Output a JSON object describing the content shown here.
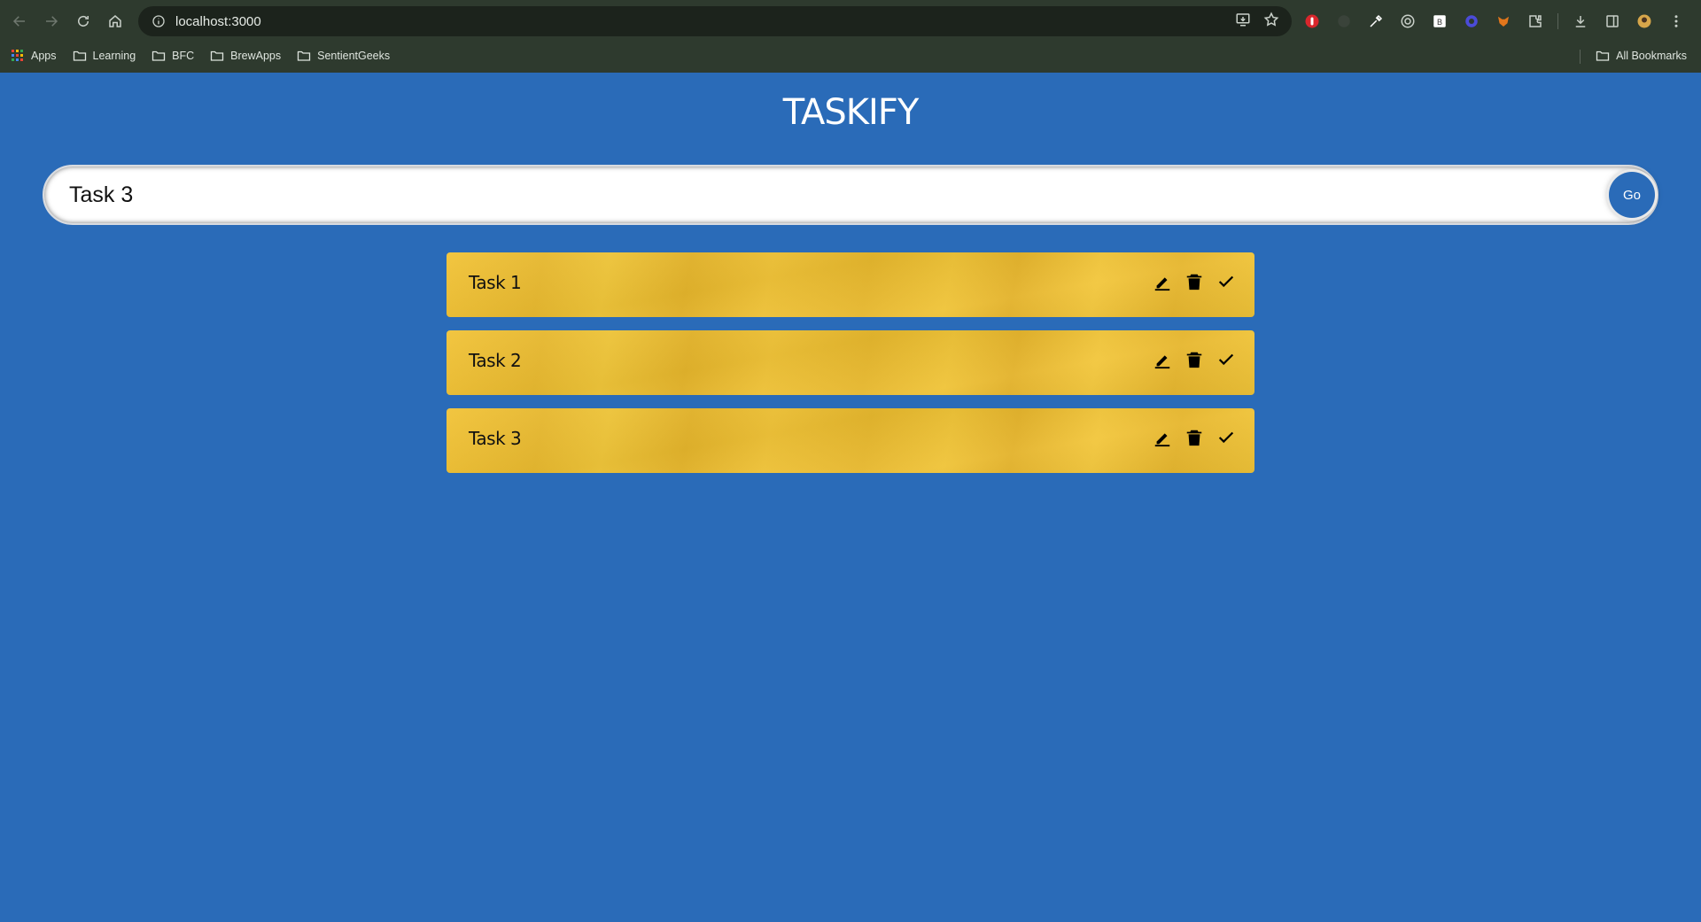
{
  "browser": {
    "url": "localhost:3000",
    "bookmarks": [
      {
        "label": "Apps",
        "icon": "apps-grid-icon"
      },
      {
        "label": "Learning",
        "icon": "folder-icon"
      },
      {
        "label": "BFC",
        "icon": "folder-icon"
      },
      {
        "label": "BrewApps",
        "icon": "folder-icon"
      },
      {
        "label": "SentientGeeks",
        "icon": "folder-icon"
      }
    ],
    "all_bookmarks_label": "All Bookmarks"
  },
  "app": {
    "title": "TASKIFY",
    "input_value": "Task 3",
    "go_label": "Go",
    "tasks": [
      {
        "text": "Task 1"
      },
      {
        "text": "Task 2"
      },
      {
        "text": "Task 3"
      }
    ]
  },
  "colors": {
    "background": "#2a6bb8",
    "card": "#f0c233",
    "chrome": "#2e3a2e"
  }
}
